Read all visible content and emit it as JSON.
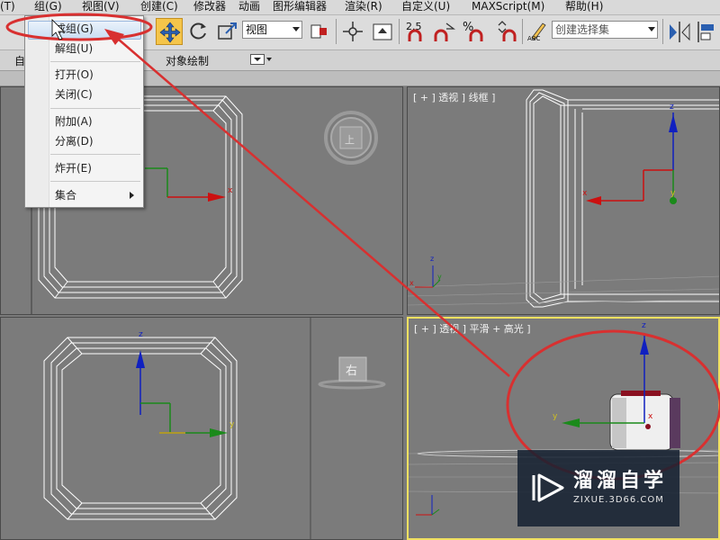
{
  "menubar": {
    "items": [
      "(T)",
      "组(G)",
      "视图(V)",
      "创建(C)",
      "修改器",
      "动画",
      "图形编辑器",
      "渲染(R)",
      "自定义(U)",
      "MAXScript(M)",
      "帮助(H)"
    ]
  },
  "toolbar": {
    "view_combo": "视图",
    "selection_set_combo": "创建选择集",
    "snap_value": "2.5",
    "percent_label": "%",
    "abc_label": "ABC"
  },
  "ribbon": {
    "left_label": "自",
    "object_paint": "对象绘制"
  },
  "group_menu": {
    "items": [
      {
        "label": "成组(G)",
        "highlighted": true
      },
      {
        "label": "解组(U)"
      },
      {
        "label": "打开(O)"
      },
      {
        "label": "关闭(C)"
      },
      {
        "label": "附加(A)"
      },
      {
        "label": "分离(D)"
      },
      {
        "label": "炸开(E)"
      },
      {
        "label": "集合",
        "submenu": true
      }
    ]
  },
  "viewports": {
    "top_left": {
      "label": "",
      "gizmo_label": "上"
    },
    "top_right": {
      "label": "[ + ] 透视 ] 线框 ]",
      "axis_x": "x",
      "axis_y": "y",
      "axis_z": "z"
    },
    "bottom_left": {
      "label": "",
      "viewcube_label": "右",
      "axis_y": "y",
      "axis_z": "z"
    },
    "bottom_right": {
      "label": "[ + ] 透视 ] 平滑 + 高光 ]",
      "axis_x": "x",
      "axis_y": "y",
      "axis_z": "z"
    }
  },
  "watermark": {
    "title": "溜溜自学",
    "subtitle": "ZIXUE.3D66.COM"
  },
  "colors": {
    "annotation_red": "#d83030",
    "active_viewport_border": "#f0e060",
    "x_axis": "#cc1010",
    "y_axis": "#1a8a1a",
    "z_axis": "#1020c0"
  }
}
